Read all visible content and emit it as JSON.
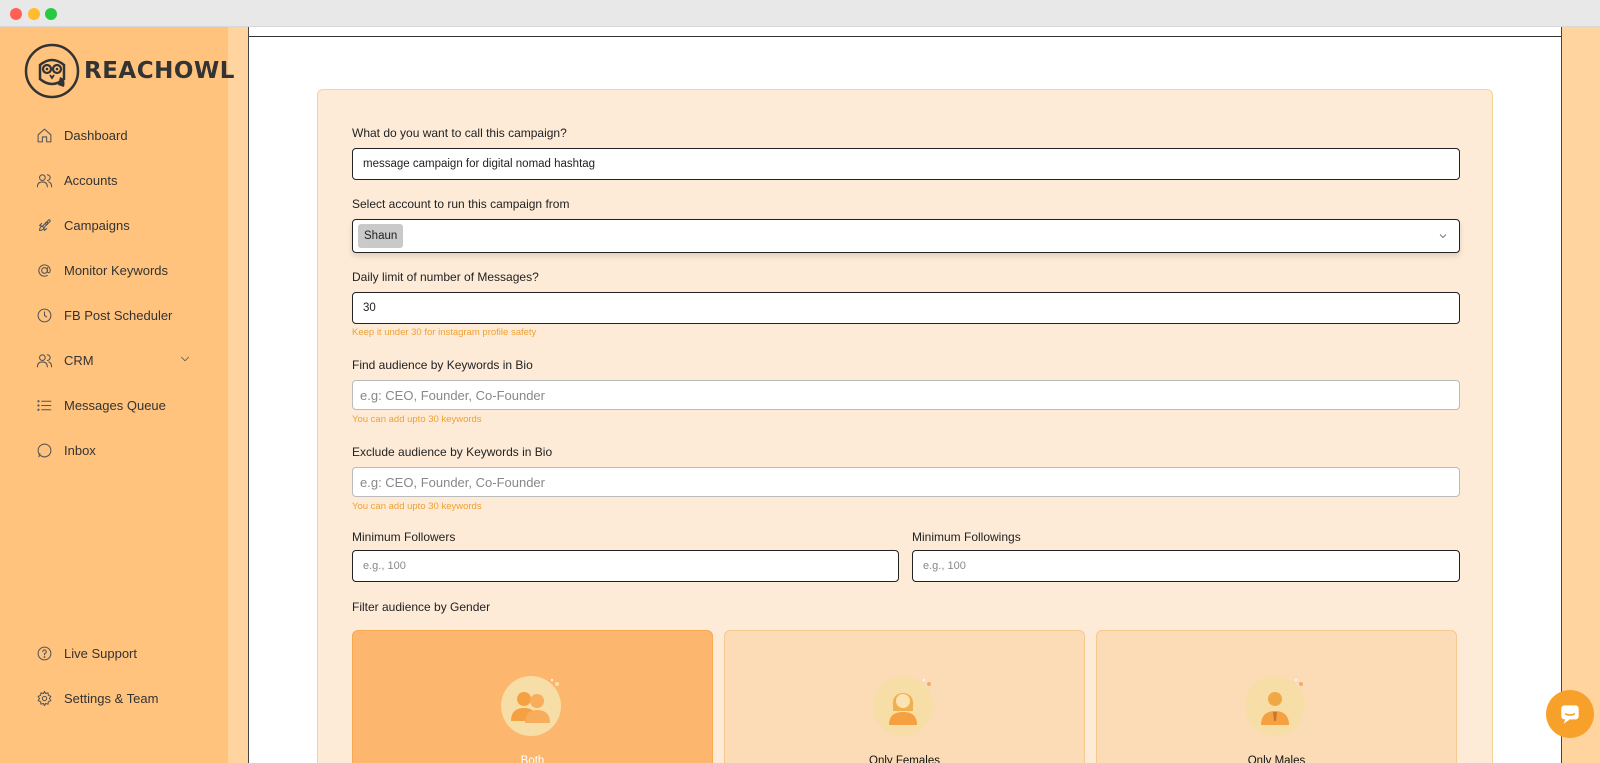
{
  "app": {
    "brand": "REACHOWL"
  },
  "sidebar": {
    "items": [
      {
        "label": "Dashboard",
        "icon": "home-icon"
      },
      {
        "label": "Accounts",
        "icon": "users-icon"
      },
      {
        "label": "Campaigns",
        "icon": "rocket-icon"
      },
      {
        "label": "Monitor Keywords",
        "icon": "at-icon"
      },
      {
        "label": "FB Post Scheduler",
        "icon": "clock-icon"
      },
      {
        "label": "CRM",
        "icon": "users-icon",
        "expandable": true
      },
      {
        "label": "Messages Queue",
        "icon": "list-icon"
      },
      {
        "label": "Inbox",
        "icon": "chat-bubble-icon"
      }
    ],
    "bottom_items": [
      {
        "label": "Live Support",
        "icon": "help-circle-icon"
      },
      {
        "label": "Settings & Team",
        "icon": "gear-icon"
      }
    ]
  },
  "form": {
    "campaign_name": {
      "label": "What do you want to call this campaign?",
      "value": "message campaign for digital nomad hashtag"
    },
    "account": {
      "label": "Select account to run this campaign from",
      "selected": "Shaun"
    },
    "daily_limit": {
      "label": "Daily limit of number of Messages?",
      "value": "30",
      "hint": "Keep it under 30 for instagram profile safety"
    },
    "include_keywords": {
      "label": "Find audience by Keywords in Bio",
      "placeholder": "e.g: CEO, Founder, Co-Founder",
      "hint": "You can add upto 30 keywords"
    },
    "exclude_keywords": {
      "label": "Exclude audience by Keywords in Bio",
      "placeholder": "e.g: CEO, Founder, Co-Founder",
      "hint": "You can add upto 30 keywords"
    },
    "min_followers": {
      "label": "Minimum Followers",
      "placeholder": "e.g., 100"
    },
    "min_followings": {
      "label": "Minimum Followings",
      "placeholder": "e.g., 100"
    },
    "gender": {
      "label": "Filter audience by Gender",
      "options": [
        {
          "label": "Both",
          "selected": true,
          "icon": "couple-icon"
        },
        {
          "label": "Only Females",
          "selected": false,
          "icon": "female-icon"
        },
        {
          "label": "Only Males",
          "selected": false,
          "icon": "male-icon"
        }
      ]
    }
  },
  "colors": {
    "sidebar_bg": "#ffc37d",
    "form_bg": "#fdebd8",
    "hint": "#f0a030",
    "selected_card": "#fdb66d",
    "accent": "#f7a12a"
  }
}
